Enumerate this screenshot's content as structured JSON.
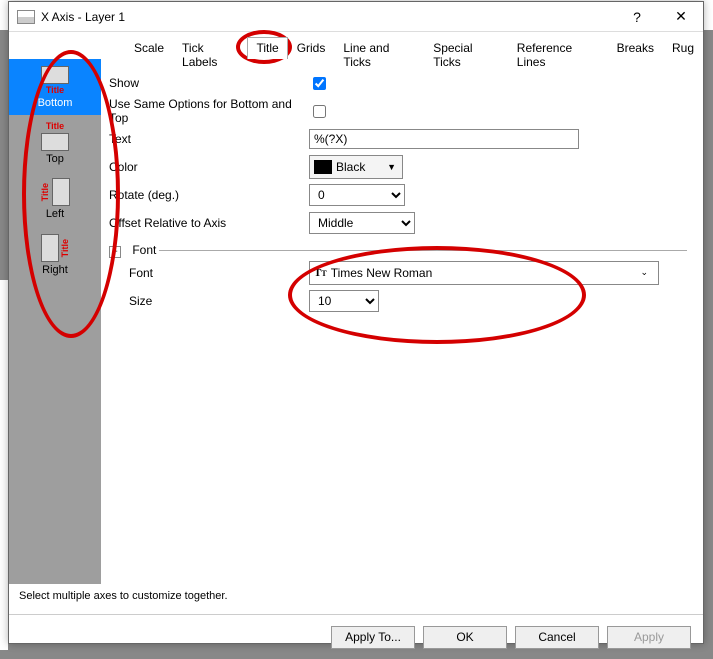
{
  "window": {
    "title": "X Axis - Layer 1"
  },
  "tabs": [
    "Scale",
    "Tick Labels",
    "Title",
    "Grids",
    "Line and Ticks",
    "Special Ticks",
    "Reference Lines",
    "Breaks",
    "Rug"
  ],
  "active_tab": "Title",
  "side": [
    {
      "label": "Bottom",
      "title_pos": "below"
    },
    {
      "label": "Top",
      "title_pos": "above"
    },
    {
      "label": "Left",
      "title_pos": "left"
    },
    {
      "label": "Right",
      "title_pos": "right"
    }
  ],
  "side_selected": "Bottom",
  "fields": {
    "show_label": "Show",
    "same_label": "Use Same Options for Bottom and Top",
    "text_label": "Text",
    "text_value": "%(?X)",
    "color_label": "Color",
    "color_value": "Black",
    "rotate_label": "Rotate (deg.)",
    "rotate_value": "0",
    "offset_label": "Offset Relative to Axis",
    "offset_value": "Middle",
    "font_group": "Font",
    "font_label": "Font",
    "font_value": "Times New Roman",
    "size_label": "Size",
    "size_value": "10"
  },
  "hint": "Select multiple axes to customize together.",
  "buttons": {
    "applyto": "Apply To...",
    "ok": "OK",
    "cancel": "Cancel",
    "apply": "Apply"
  }
}
